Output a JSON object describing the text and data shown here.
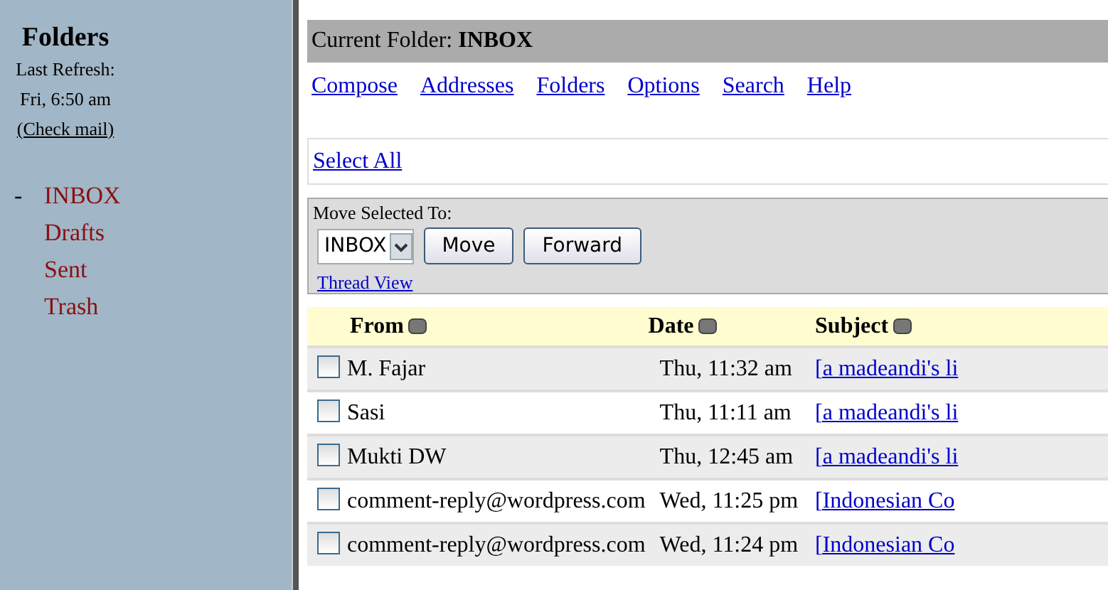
{
  "sidebar": {
    "title": "Folders",
    "refresh_label": "Last Refresh:",
    "refresh_time": "Fri, 6:50 am",
    "check_mail": "(Check mail)",
    "folders": [
      {
        "toggle": "-",
        "name": "INBOX"
      },
      {
        "name": "Drafts"
      },
      {
        "name": "Sent"
      },
      {
        "name": "Trash"
      }
    ]
  },
  "current_folder": {
    "label": "Current Folder:",
    "name": "INBOX"
  },
  "nav_links": [
    "Compose",
    "Addresses",
    "Folders",
    "Options",
    "Search",
    "Help"
  ],
  "select_all": "Select All",
  "move_panel": {
    "label": "Move Selected To:",
    "folder": "INBOX",
    "buttons": [
      "Move",
      "Forward"
    ],
    "thread_view": "Thread View"
  },
  "table": {
    "columns": [
      "From",
      "Date",
      "Subject"
    ],
    "rows": [
      {
        "checked": false,
        "from": "M. Fajar",
        "date": "Thu, 11:32 am",
        "subject": "[a madeandi's li"
      },
      {
        "checked": false,
        "from": "Sasi",
        "date": "Thu, 11:11 am",
        "subject": "[a madeandi's li"
      },
      {
        "checked": false,
        "from": "Mukti DW",
        "date": "Thu, 12:45 am",
        "subject": "[a madeandi's li"
      },
      {
        "checked": false,
        "from": "comment-reply@wordpress.com",
        "date": "Wed, 11:25 pm",
        "subject": "[Indonesian Co"
      },
      {
        "checked": false,
        "from": "comment-reply@wordpress.com",
        "date": "Wed, 11:24 pm",
        "subject": "[Indonesian Co"
      }
    ]
  }
}
